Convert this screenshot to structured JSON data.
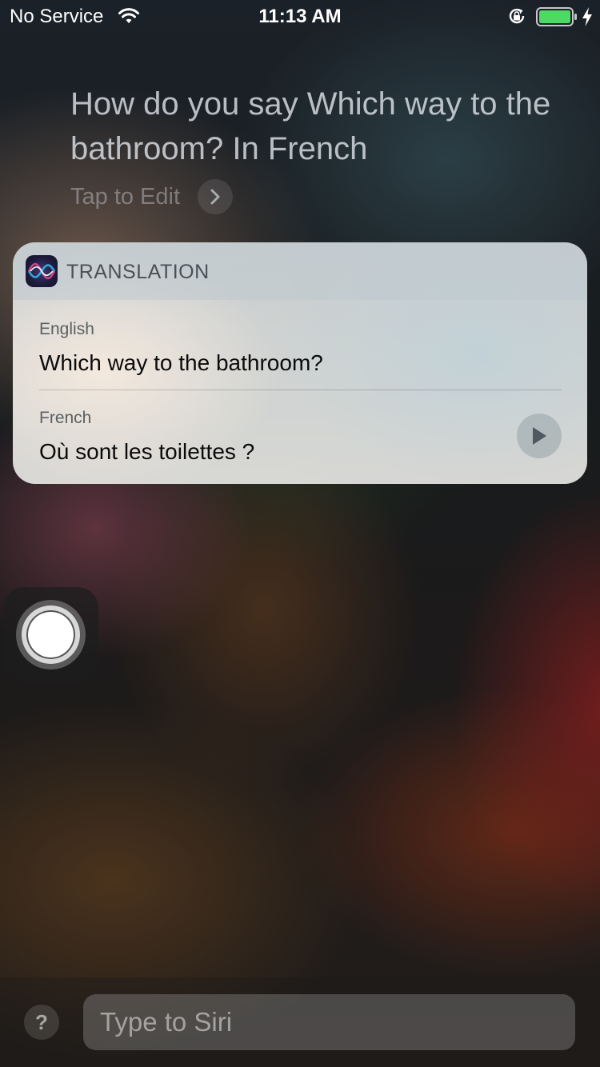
{
  "status_bar": {
    "carrier": "No Service",
    "time": "11:13 AM",
    "battery_color": "#4cd964"
  },
  "siri": {
    "query": "How do you say Which way to the bathroom? In French",
    "tap_to_edit": "Tap to Edit"
  },
  "card": {
    "title": "TRANSLATION",
    "source": {
      "language": "English",
      "text": "Which way to the bathroom?"
    },
    "target": {
      "language": "French",
      "text": "Où sont les toilettes ?"
    }
  },
  "input": {
    "placeholder": "Type to Siri"
  },
  "help": {
    "label": "?"
  },
  "icons": [
    "wifi-icon",
    "rotation-lock-icon",
    "battery-icon",
    "charging-icon",
    "chevron-right-icon",
    "siri-icon",
    "play-icon"
  ]
}
